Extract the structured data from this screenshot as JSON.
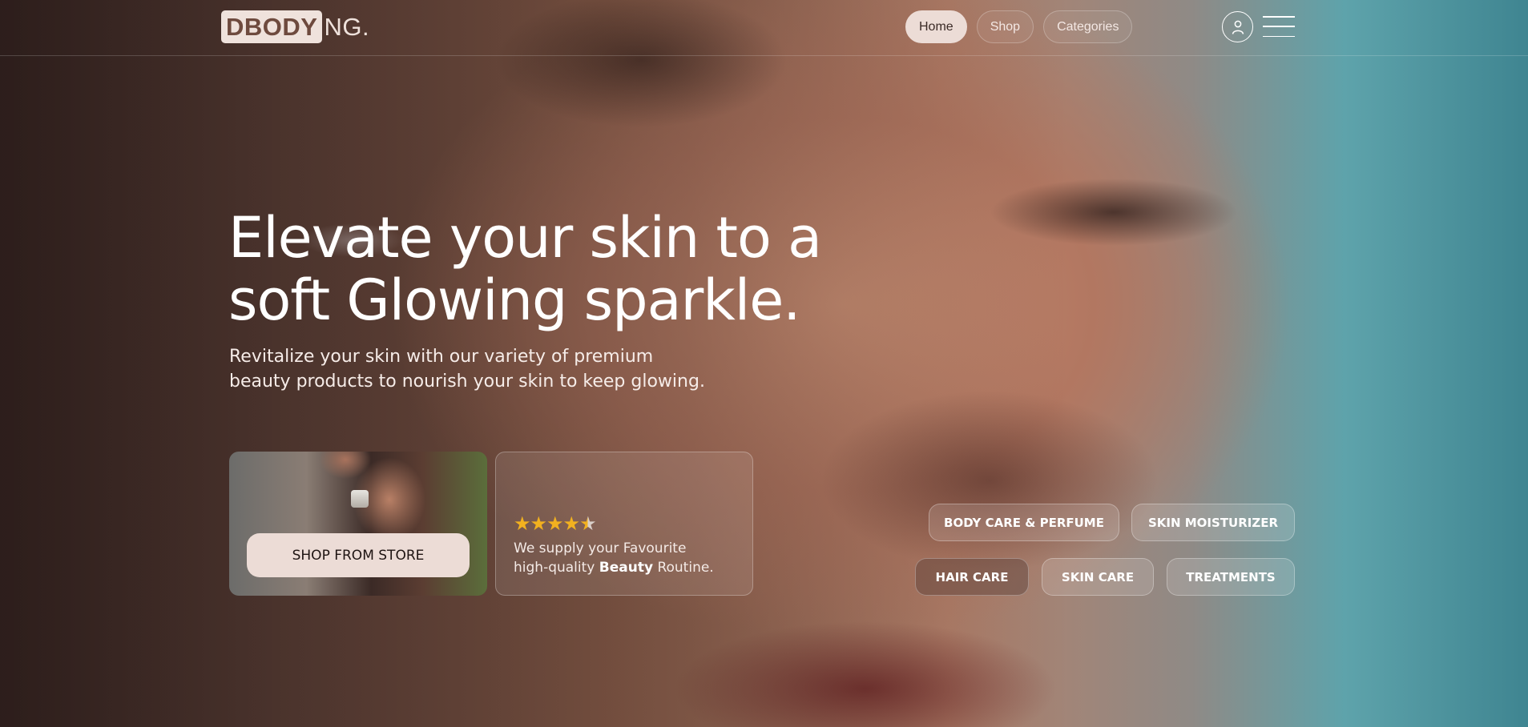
{
  "brand": {
    "logo_box_text": "DBODY",
    "logo_rest_text": "NG."
  },
  "nav": {
    "items": [
      {
        "label": "Home",
        "active": true
      },
      {
        "label": "Shop",
        "active": false
      },
      {
        "label": "Categories",
        "active": false
      }
    ],
    "icons": {
      "account": "user-icon",
      "menu": "hamburger-menu-icon"
    }
  },
  "hero": {
    "headline_line1": "Elevate your skin to a",
    "headline_line2": "soft Glowing sparkle.",
    "subtext_line1": "Revitalize your skin with our variety of premium",
    "subtext_line2": "beauty products to nourish your skin to keep glowing."
  },
  "store_card": {
    "button_label": "SHOP FROM STORE"
  },
  "rating_card": {
    "rating": 4.5,
    "max_rating": 5,
    "text_line1": "We supply your Favourite",
    "text_line2_prefix": "high-quality ",
    "text_line2_bold": "Beauty",
    "text_line2_suffix": " Routine."
  },
  "categories": {
    "row1": [
      "BODY CARE & PERFUME",
      "SKIN MOISTURIZER"
    ],
    "row2": [
      "HAIR CARE",
      "SKIN CARE",
      "TREATMENTS"
    ]
  },
  "colors": {
    "accent_light": "#ecdcd6",
    "star": "#f2b11f",
    "logo_brown": "#6e4a3e"
  }
}
